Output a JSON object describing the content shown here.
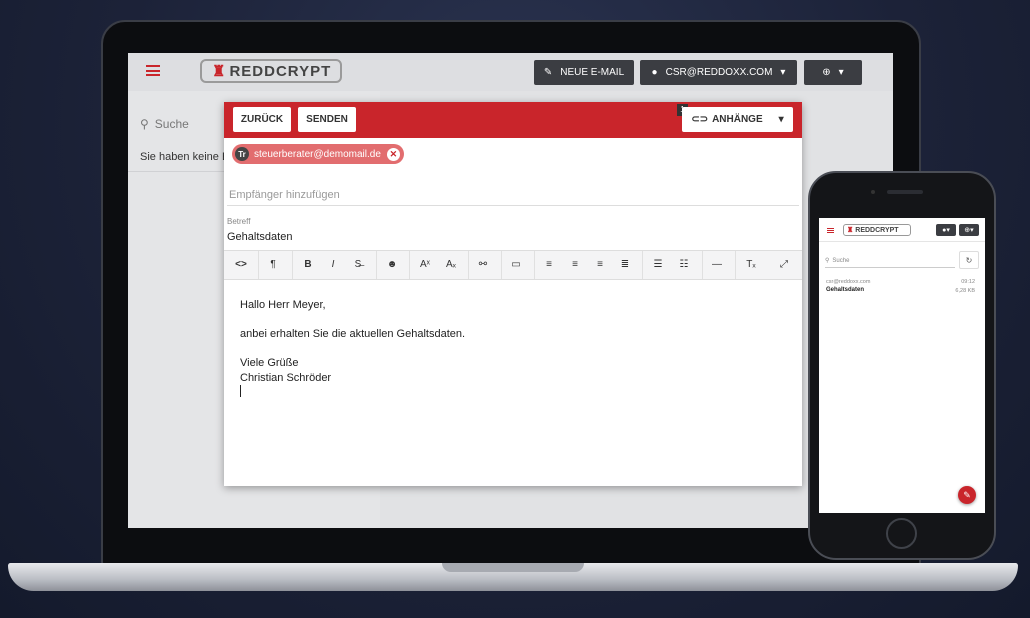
{
  "app": {
    "logo_text": "REDDCRYPT",
    "accent_color": "#c9252b"
  },
  "header": {
    "new_mail_label": "NEUE E-MAIL",
    "account_label": "CSR@REDDOXX.COM"
  },
  "left_pane": {
    "search_placeholder": "Suche",
    "empty_message": "Sie haben keine E"
  },
  "compose": {
    "back_label": "ZURÜCK",
    "send_label": "SENDEN",
    "attachments_label": "ANHÄNGE",
    "attachments_count": "1",
    "recipient_avatar": "Tr",
    "recipient_email": "steuerberater@demomail.de",
    "to_placeholder": "Empfänger hinzufügen",
    "subject_label": "Betreff",
    "subject_value": "Gehaltsdaten",
    "body": {
      "greeting": "Hallo Herr Meyer,",
      "line1": "anbei erhalten Sie die aktuellen Gehaltsdaten.",
      "closing": "Viele Grüße",
      "signature": "Christian Schröder"
    }
  },
  "phone": {
    "logo_text": "REDDCRYPT",
    "search_placeholder": "Suche",
    "message": {
      "from": "csr@reddoxx.com",
      "subject": "Gehaltsdaten",
      "time": "09:12",
      "size": "6,28 KB"
    }
  }
}
